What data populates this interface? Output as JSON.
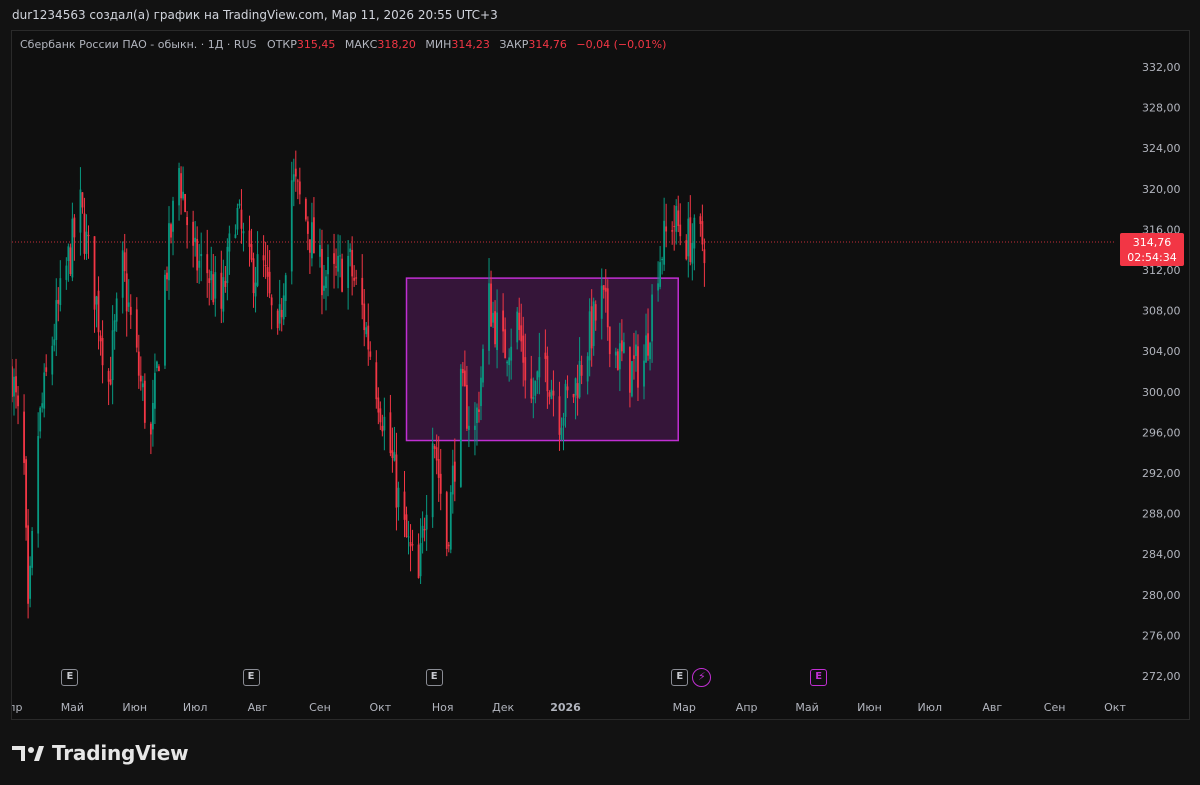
{
  "header": {
    "attribution": "dur1234563 создал(а) график на TradingView.com, Мар 11, 2026 20:55 UTC+3"
  },
  "legend": {
    "symbol": "Сбербанк России ПАО - обыкн. · 1Д · RUS",
    "open_label": "ОТКР",
    "open_value": "315,45",
    "high_label": "МАКС",
    "high_value": "318,20",
    "low_label": "МИН",
    "low_value": "314,23",
    "close_label": "ЗАКР",
    "close_value": "314,76",
    "change": "−0,04 (−0,01%)"
  },
  "price_tag": {
    "price": "314,76",
    "countdown": "02:54:34"
  },
  "events": {
    "earnings_glyph": "E",
    "split_glyph": "⚡",
    "dividend_glyph": "E"
  },
  "brand": {
    "name": "TradingView",
    "logo_icon": "tradingview-logo-icon"
  },
  "colors": {
    "up": "#089981",
    "down": "#f23645",
    "rectangle": "#c02fd2",
    "background": "#0f0f0f"
  },
  "chart_data": {
    "type": "candlestick",
    "y_axis": {
      "min": 270,
      "max": 334,
      "ticks": [
        "272,00",
        "276,00",
        "280,00",
        "284,00",
        "288,00",
        "292,00",
        "296,00",
        "300,00",
        "304,00",
        "308,00",
        "312,00",
        "316,00",
        "320,00",
        "324,00",
        "328,00",
        "332,00"
      ],
      "tick_values": [
        272,
        276,
        280,
        284,
        288,
        292,
        296,
        300,
        304,
        308,
        312,
        316,
        320,
        324,
        328,
        332
      ]
    },
    "x_axis": {
      "labels": [
        "апр",
        "Май",
        "Июн",
        "Июл",
        "Авг",
        "Сен",
        "Окт",
        "Ноя",
        "Дек",
        "2026",
        "Мар",
        "Апр",
        "Май",
        "Июн",
        "Июл",
        "Авг",
        "Сен",
        "Окт"
      ],
      "label_dates": [
        "2025-04-01",
        "2025-05-01",
        "2025-06-01",
        "2025-07-01",
        "2025-08-01",
        "2025-09-01",
        "2025-10-01",
        "2025-11-01",
        "2025-12-01",
        "2026-01-01",
        "2026-03-01",
        "2026-04-01",
        "2026-05-01",
        "2026-06-01",
        "2026-07-01",
        "2026-08-01",
        "2026-09-01",
        "2026-10-01"
      ],
      "bold_label": "2026",
      "range": [
        "2025-04-01",
        "2026-10-01"
      ]
    },
    "current_price": 314.76,
    "rectangle": {
      "x_from": "2025-10-14",
      "x_to": "2026-02-26",
      "y_from": 295.2,
      "y_to": 311.2
    },
    "event_markers": [
      {
        "kind": "earnings",
        "x": "2025-04-30"
      },
      {
        "kind": "earnings",
        "x": "2025-07-29"
      },
      {
        "kind": "earnings",
        "x": "2025-10-28"
      },
      {
        "kind": "earnings",
        "x": "2026-02-27"
      },
      {
        "kind": "split",
        "x": "2026-03-10"
      },
      {
        "kind": "dividend",
        "x": "2026-05-07"
      }
    ],
    "anchors": [
      [
        "2025-04-01",
        302
      ],
      [
        "2025-04-07",
        292
      ],
      [
        "2025-04-09",
        277
      ],
      [
        "2025-04-14",
        296
      ],
      [
        "2025-04-21",
        305
      ],
      [
        "2025-04-28",
        312
      ],
      [
        "2025-05-05",
        318
      ],
      [
        "2025-05-12",
        310
      ],
      [
        "2025-05-19",
        301
      ],
      [
        "2025-05-26",
        312
      ],
      [
        "2025-06-02",
        303
      ],
      [
        "2025-06-09",
        295
      ],
      [
        "2025-06-16",
        311
      ],
      [
        "2025-06-23",
        322
      ],
      [
        "2025-06-30",
        313
      ],
      [
        "2025-07-07",
        312
      ],
      [
        "2025-07-14",
        308
      ],
      [
        "2025-07-21",
        318
      ],
      [
        "2025-07-28",
        312
      ],
      [
        "2025-08-04",
        312
      ],
      [
        "2025-08-11",
        304
      ],
      [
        "2025-08-18",
        321
      ],
      [
        "2025-08-25",
        317
      ],
      [
        "2025-09-01",
        312
      ],
      [
        "2025-09-08",
        311
      ],
      [
        "2025-09-15",
        313
      ],
      [
        "2025-09-22",
        308
      ],
      [
        "2025-09-29",
        301
      ],
      [
        "2025-10-06",
        294
      ],
      [
        "2025-10-13",
        286
      ],
      [
        "2025-10-20",
        281
      ],
      [
        "2025-10-27",
        297
      ],
      [
        "2025-11-03",
        285
      ],
      [
        "2025-11-10",
        300
      ],
      [
        "2025-11-17",
        296
      ],
      [
        "2025-11-24",
        309
      ],
      [
        "2025-12-01",
        304
      ],
      [
        "2025-12-08",
        307
      ],
      [
        "2025-12-15",
        299
      ],
      [
        "2025-12-22",
        303
      ],
      [
        "2025-12-29",
        298
      ],
      [
        "2026-01-05",
        300
      ],
      [
        "2026-01-12",
        305
      ],
      [
        "2026-01-19",
        309
      ],
      [
        "2026-01-26",
        304
      ],
      [
        "2026-02-02",
        302
      ],
      [
        "2026-02-09",
        303
      ],
      [
        "2026-02-16",
        313
      ],
      [
        "2026-02-23",
        317
      ],
      [
        "2026-03-02",
        315
      ],
      [
        "2026-03-11",
        314.76
      ]
    ]
  }
}
